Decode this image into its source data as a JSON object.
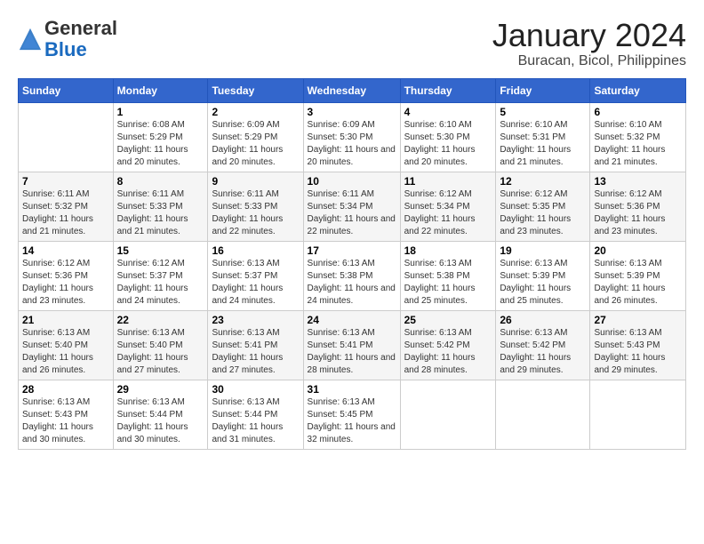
{
  "header": {
    "logo_general": "General",
    "logo_blue": "Blue",
    "title": "January 2024",
    "subtitle": "Buracan, Bicol, Philippines"
  },
  "days_of_week": [
    "Sunday",
    "Monday",
    "Tuesday",
    "Wednesday",
    "Thursday",
    "Friday",
    "Saturday"
  ],
  "weeks": [
    [
      {
        "day": "",
        "sunrise": "",
        "sunset": "",
        "daylight": ""
      },
      {
        "day": "1",
        "sunrise": "6:08 AM",
        "sunset": "5:29 PM",
        "daylight": "11 hours and 20 minutes."
      },
      {
        "day": "2",
        "sunrise": "6:09 AM",
        "sunset": "5:29 PM",
        "daylight": "11 hours and 20 minutes."
      },
      {
        "day": "3",
        "sunrise": "6:09 AM",
        "sunset": "5:30 PM",
        "daylight": "11 hours and 20 minutes."
      },
      {
        "day": "4",
        "sunrise": "6:10 AM",
        "sunset": "5:30 PM",
        "daylight": "11 hours and 20 minutes."
      },
      {
        "day": "5",
        "sunrise": "6:10 AM",
        "sunset": "5:31 PM",
        "daylight": "11 hours and 21 minutes."
      },
      {
        "day": "6",
        "sunrise": "6:10 AM",
        "sunset": "5:32 PM",
        "daylight": "11 hours and 21 minutes."
      }
    ],
    [
      {
        "day": "7",
        "sunrise": "6:11 AM",
        "sunset": "5:32 PM",
        "daylight": "11 hours and 21 minutes."
      },
      {
        "day": "8",
        "sunrise": "6:11 AM",
        "sunset": "5:33 PM",
        "daylight": "11 hours and 21 minutes."
      },
      {
        "day": "9",
        "sunrise": "6:11 AM",
        "sunset": "5:33 PM",
        "daylight": "11 hours and 22 minutes."
      },
      {
        "day": "10",
        "sunrise": "6:11 AM",
        "sunset": "5:34 PM",
        "daylight": "11 hours and 22 minutes."
      },
      {
        "day": "11",
        "sunrise": "6:12 AM",
        "sunset": "5:34 PM",
        "daylight": "11 hours and 22 minutes."
      },
      {
        "day": "12",
        "sunrise": "6:12 AM",
        "sunset": "5:35 PM",
        "daylight": "11 hours and 23 minutes."
      },
      {
        "day": "13",
        "sunrise": "6:12 AM",
        "sunset": "5:36 PM",
        "daylight": "11 hours and 23 minutes."
      }
    ],
    [
      {
        "day": "14",
        "sunrise": "6:12 AM",
        "sunset": "5:36 PM",
        "daylight": "11 hours and 23 minutes."
      },
      {
        "day": "15",
        "sunrise": "6:12 AM",
        "sunset": "5:37 PM",
        "daylight": "11 hours and 24 minutes."
      },
      {
        "day": "16",
        "sunrise": "6:13 AM",
        "sunset": "5:37 PM",
        "daylight": "11 hours and 24 minutes."
      },
      {
        "day": "17",
        "sunrise": "6:13 AM",
        "sunset": "5:38 PM",
        "daylight": "11 hours and 24 minutes."
      },
      {
        "day": "18",
        "sunrise": "6:13 AM",
        "sunset": "5:38 PM",
        "daylight": "11 hours and 25 minutes."
      },
      {
        "day": "19",
        "sunrise": "6:13 AM",
        "sunset": "5:39 PM",
        "daylight": "11 hours and 25 minutes."
      },
      {
        "day": "20",
        "sunrise": "6:13 AM",
        "sunset": "5:39 PM",
        "daylight": "11 hours and 26 minutes."
      }
    ],
    [
      {
        "day": "21",
        "sunrise": "6:13 AM",
        "sunset": "5:40 PM",
        "daylight": "11 hours and 26 minutes."
      },
      {
        "day": "22",
        "sunrise": "6:13 AM",
        "sunset": "5:40 PM",
        "daylight": "11 hours and 27 minutes."
      },
      {
        "day": "23",
        "sunrise": "6:13 AM",
        "sunset": "5:41 PM",
        "daylight": "11 hours and 27 minutes."
      },
      {
        "day": "24",
        "sunrise": "6:13 AM",
        "sunset": "5:41 PM",
        "daylight": "11 hours and 28 minutes."
      },
      {
        "day": "25",
        "sunrise": "6:13 AM",
        "sunset": "5:42 PM",
        "daylight": "11 hours and 28 minutes."
      },
      {
        "day": "26",
        "sunrise": "6:13 AM",
        "sunset": "5:42 PM",
        "daylight": "11 hours and 29 minutes."
      },
      {
        "day": "27",
        "sunrise": "6:13 AM",
        "sunset": "5:43 PM",
        "daylight": "11 hours and 29 minutes."
      }
    ],
    [
      {
        "day": "28",
        "sunrise": "6:13 AM",
        "sunset": "5:43 PM",
        "daylight": "11 hours and 30 minutes."
      },
      {
        "day": "29",
        "sunrise": "6:13 AM",
        "sunset": "5:44 PM",
        "daylight": "11 hours and 30 minutes."
      },
      {
        "day": "30",
        "sunrise": "6:13 AM",
        "sunset": "5:44 PM",
        "daylight": "11 hours and 31 minutes."
      },
      {
        "day": "31",
        "sunrise": "6:13 AM",
        "sunset": "5:45 PM",
        "daylight": "11 hours and 32 minutes."
      },
      {
        "day": "",
        "sunrise": "",
        "sunset": "",
        "daylight": ""
      },
      {
        "day": "",
        "sunrise": "",
        "sunset": "",
        "daylight": ""
      },
      {
        "day": "",
        "sunrise": "",
        "sunset": "",
        "daylight": ""
      }
    ]
  ]
}
